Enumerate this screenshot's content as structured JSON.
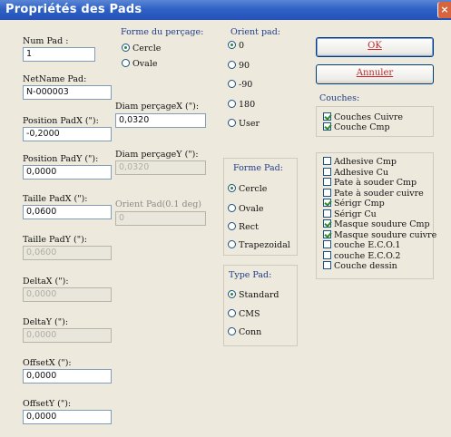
{
  "window": {
    "title": "Propriétés des Pads",
    "close_label": "×"
  },
  "left_fields": [
    {
      "label": "Num Pad :",
      "value": "1",
      "enabled": true
    },
    {
      "label": "NetName Pad:",
      "value": "N-000003",
      "enabled": true
    },
    {
      "label": "Position PadX (\"):",
      "value": "-0,2000",
      "enabled": true
    },
    {
      "label": "Position PadY (\"):",
      "value": "0,0000",
      "enabled": true
    },
    {
      "label": "Taille PadX (\"):",
      "value": "0,0600",
      "enabled": true
    },
    {
      "label": "Taille PadY (\"):",
      "value": "0,0600",
      "enabled": false
    },
    {
      "label": "DeltaX (\"):",
      "value": "0,0000",
      "enabled": false
    },
    {
      "label": "DeltaY (\"):",
      "value": "0,0000",
      "enabled": false
    },
    {
      "label": "OffsetX (\"):",
      "value": "0,0000",
      "enabled": true
    },
    {
      "label": "OffsetY (\"):",
      "value": "0,0000",
      "enabled": true
    }
  ],
  "drill": {
    "title": "Forme du perçage:",
    "options": [
      {
        "label": "Cercle",
        "selected": true
      },
      {
        "label": "Ovale",
        "selected": false
      }
    ],
    "diam_x_label": "Diam perçageX (\"):",
    "diam_x_value": "0,0320",
    "diam_y_label": "Diam perçageY (\"):",
    "diam_y_value": "0,0320",
    "orient_label": "Orient Pad(0.1 deg)",
    "orient_value": "0"
  },
  "orient": {
    "title": "Orient pad:",
    "options": [
      {
        "label": "0",
        "selected": true
      },
      {
        "label": "90",
        "selected": false
      },
      {
        "label": "-90",
        "selected": false
      },
      {
        "label": "180",
        "selected": false
      },
      {
        "label": "User",
        "selected": false
      }
    ]
  },
  "shape": {
    "title": "Forme Pad:",
    "options": [
      {
        "label": "Cercle",
        "selected": true
      },
      {
        "label": "Ovale",
        "selected": false
      },
      {
        "label": "Rect",
        "selected": false
      },
      {
        "label": "Trapezoidal",
        "selected": false
      }
    ]
  },
  "type": {
    "title": "Type Pad:",
    "options": [
      {
        "label": "Standard",
        "selected": true
      },
      {
        "label": "CMS",
        "selected": false
      },
      {
        "label": "Conn",
        "selected": false
      }
    ]
  },
  "buttons": {
    "ok": "OK",
    "cancel": "Annuler"
  },
  "layers": {
    "title": "Couches:",
    "top": [
      {
        "label": "Couches Cuivre",
        "checked": true
      },
      {
        "label": "Couche Cmp",
        "checked": true
      }
    ],
    "list": [
      {
        "label": "Adhesive Cmp",
        "checked": false
      },
      {
        "label": "Adhesive Cu",
        "checked": false
      },
      {
        "label": "Pate à souder Cmp",
        "checked": false
      },
      {
        "label": "Pate à souder cuivre",
        "checked": false
      },
      {
        "label": "Sérigr Cmp",
        "checked": true
      },
      {
        "label": "Sérigr Cu",
        "checked": false
      },
      {
        "label": "Masque soudure Cmp",
        "checked": true
      },
      {
        "label": "Masque soudure cuivre",
        "checked": true
      },
      {
        "label": "couche E.C.O.1",
        "checked": false
      },
      {
        "label": "couche E.C.O.2",
        "checked": false
      },
      {
        "label": "Couche dessin",
        "checked": false
      }
    ]
  },
  "colors": {
    "titlebar": "#2f62c6",
    "accent_red": "#c0282b",
    "check_green": "#2d8a2d"
  }
}
